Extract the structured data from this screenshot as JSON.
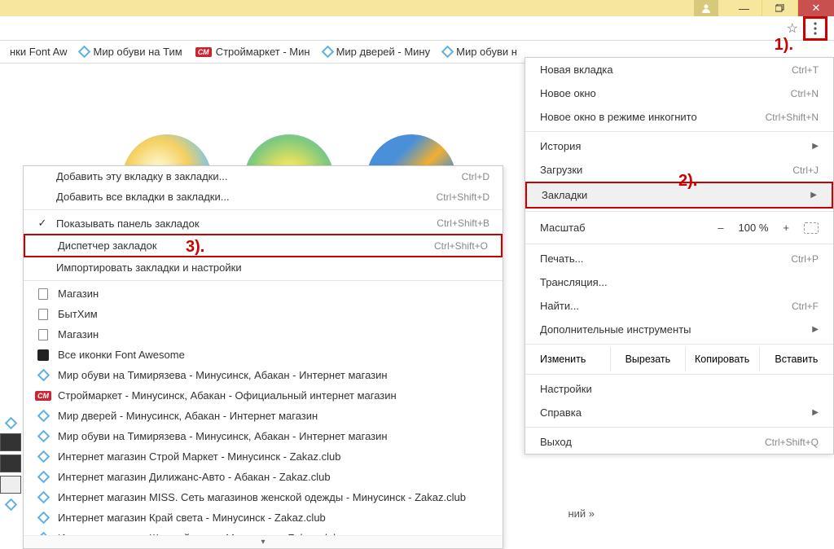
{
  "annotations": {
    "a1": "1).",
    "a2": "2).",
    "a3": "3)."
  },
  "bookmark_bar": [
    {
      "label": "нки Font Aw"
    },
    {
      "label": "Мир обуви на Тим"
    },
    {
      "label": "Строймаркет - Мин",
      "type": "cm"
    },
    {
      "label": "Мир дверей - Мину"
    },
    {
      "label": "Мир обуви н"
    }
  ],
  "main_menu": {
    "new_tab": {
      "label": "Новая вкладка",
      "shortcut": "Ctrl+T"
    },
    "new_window": {
      "label": "Новое окно",
      "shortcut": "Ctrl+N"
    },
    "incognito": {
      "label": "Новое окно в режиме инкогнито",
      "shortcut": "Ctrl+Shift+N"
    },
    "history": {
      "label": "История"
    },
    "downloads": {
      "label": "Загрузки",
      "shortcut": "Ctrl+J"
    },
    "bookmarks": {
      "label": "Закладки"
    },
    "zoom_label": "Масштаб",
    "zoom_value": "100 %",
    "print": {
      "label": "Печать...",
      "shortcut": "Ctrl+P"
    },
    "cast": {
      "label": "Трансляция..."
    },
    "find": {
      "label": "Найти...",
      "shortcut": "Ctrl+F"
    },
    "more_tools": {
      "label": "Дополнительные инструменты"
    },
    "edit_label": "Изменить",
    "cut": "Вырезать",
    "copy": "Копировать",
    "paste": "Вставить",
    "settings": {
      "label": "Настройки"
    },
    "help": {
      "label": "Справка"
    },
    "exit": {
      "label": "Выход",
      "shortcut": "Ctrl+Shift+Q"
    }
  },
  "sub_menu": {
    "add_page": {
      "label": "Добавить эту вкладку в закладки...",
      "shortcut": "Ctrl+D"
    },
    "add_all": {
      "label": "Добавить все вкладки в закладки...",
      "shortcut": "Ctrl+Shift+D"
    },
    "show_bar": {
      "label": "Показывать панель закладок",
      "shortcut": "Ctrl+Shift+B"
    },
    "manager": {
      "label": "Диспетчер закладок",
      "shortcut": "Ctrl+Shift+O"
    },
    "import": {
      "label": "Импортировать закладки и настройки"
    },
    "list": [
      {
        "icon": "doc",
        "label": "Магазин"
      },
      {
        "icon": "doc",
        "label": "БытХим"
      },
      {
        "icon": "doc",
        "label": "Магазин"
      },
      {
        "icon": "fa",
        "label": "Все иконки Font Awesome"
      },
      {
        "icon": "d",
        "label": "Мир обуви на Тимирязева - Минусинск, Абакан - Интернет магазин"
      },
      {
        "icon": "cm",
        "label": "Строймаркет - Минусинск, Абакан - Официальный интернет магазин"
      },
      {
        "icon": "d",
        "label": "Мир дверей - Минусинск, Абакан - Интернет магазин"
      },
      {
        "icon": "d",
        "label": "Мир обуви на Тимирязева - Минусинск, Абакан - Интернет магазин"
      },
      {
        "icon": "d",
        "label": "Интернет магазин Строй Маркет - Минусинск - Zakaz.club"
      },
      {
        "icon": "d",
        "label": "Интернет магазин Дилижанс-Авто - Абакан - Zakaz.club"
      },
      {
        "icon": "d",
        "label": "Интернет магазин MISS. Сеть магазинов женской одежды - Минусинск - Zakaz.club"
      },
      {
        "icon": "d",
        "label": "Интернет магазин Край света - Минусинск - Zakaz.club"
      },
      {
        "icon": "d",
        "label": "Интернет магазин Шинный двор - Минусинск - Zakaz.club"
      }
    ]
  },
  "bottom_stub": "ний »"
}
